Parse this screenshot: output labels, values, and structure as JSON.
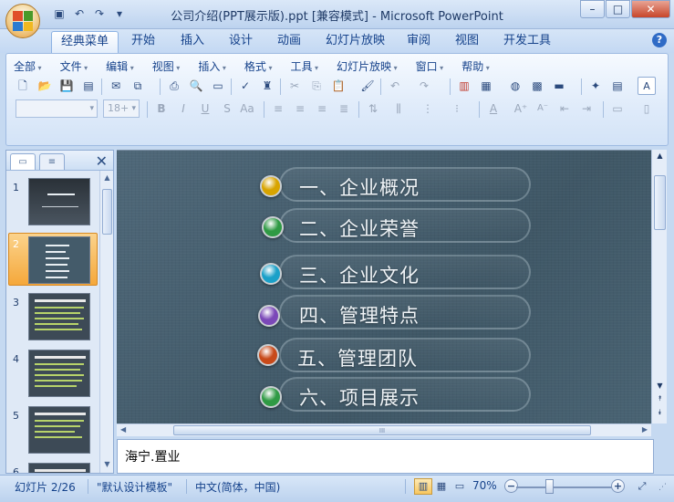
{
  "window": {
    "title": "公司介绍(PPT展示版).ppt [兼容模式] - Microsoft PowerPoint",
    "qat_icons": [
      "save-icon",
      "undo-icon",
      "redo-icon",
      "qat-dropdown-icon"
    ],
    "controls": {
      "minimize": "–",
      "maximize": "□",
      "close": "✕"
    }
  },
  "ribbon_tabs": [
    {
      "label": "经典菜单",
      "active": true
    },
    {
      "label": "开始"
    },
    {
      "label": "插入"
    },
    {
      "label": "设计"
    },
    {
      "label": "动画"
    },
    {
      "label": "幻灯片放映"
    },
    {
      "label": "审阅"
    },
    {
      "label": "视图"
    },
    {
      "label": "开发工具"
    }
  ],
  "help_label": "?",
  "menus": [
    "全部",
    "文件",
    "编辑",
    "视图",
    "插入",
    "格式",
    "工具",
    "幻灯片放映",
    "窗口",
    "帮助"
  ],
  "toolbar": {
    "font_name": "",
    "font_size": "18+",
    "format_labels": {
      "bold": "B",
      "italic": "I",
      "underline": "U",
      "shadow": "S",
      "case": "Aa",
      "font_color": "A",
      "text_box": "A"
    }
  },
  "left_pane": {
    "tab_slides_icon": "slides-icon",
    "tab_outline_icon": "outline-icon",
    "close_label": "✕",
    "thumbnails": [
      {
        "num": "1"
      },
      {
        "num": "2",
        "selected": true
      },
      {
        "num": "3"
      },
      {
        "num": "4"
      },
      {
        "num": "5"
      },
      {
        "num": "6"
      }
    ]
  },
  "slide": {
    "items": [
      {
        "text": "一、企业概况",
        "color": "#d8a400"
      },
      {
        "text": "二、企业荣誉",
        "color": "#2f9a44"
      },
      {
        "text": "三、企业文化",
        "color": "#1aa0c8"
      },
      {
        "text": "四、管理特点",
        "color": "#7b48b8"
      },
      {
        "text": "五、管理团队",
        "color": "#c84a1a"
      },
      {
        "text": "六、项目展示",
        "color": "#2f9a44"
      }
    ]
  },
  "hscroll_grip": "III",
  "notes": {
    "text": "海宁.置业"
  },
  "status": {
    "slide_indicator": "幻灯片 2/26",
    "theme": "\"默认设计模板\"",
    "language": "中文(简体，中国)",
    "zoom": "70%",
    "zoom_minus": "−",
    "zoom_plus": "+"
  }
}
